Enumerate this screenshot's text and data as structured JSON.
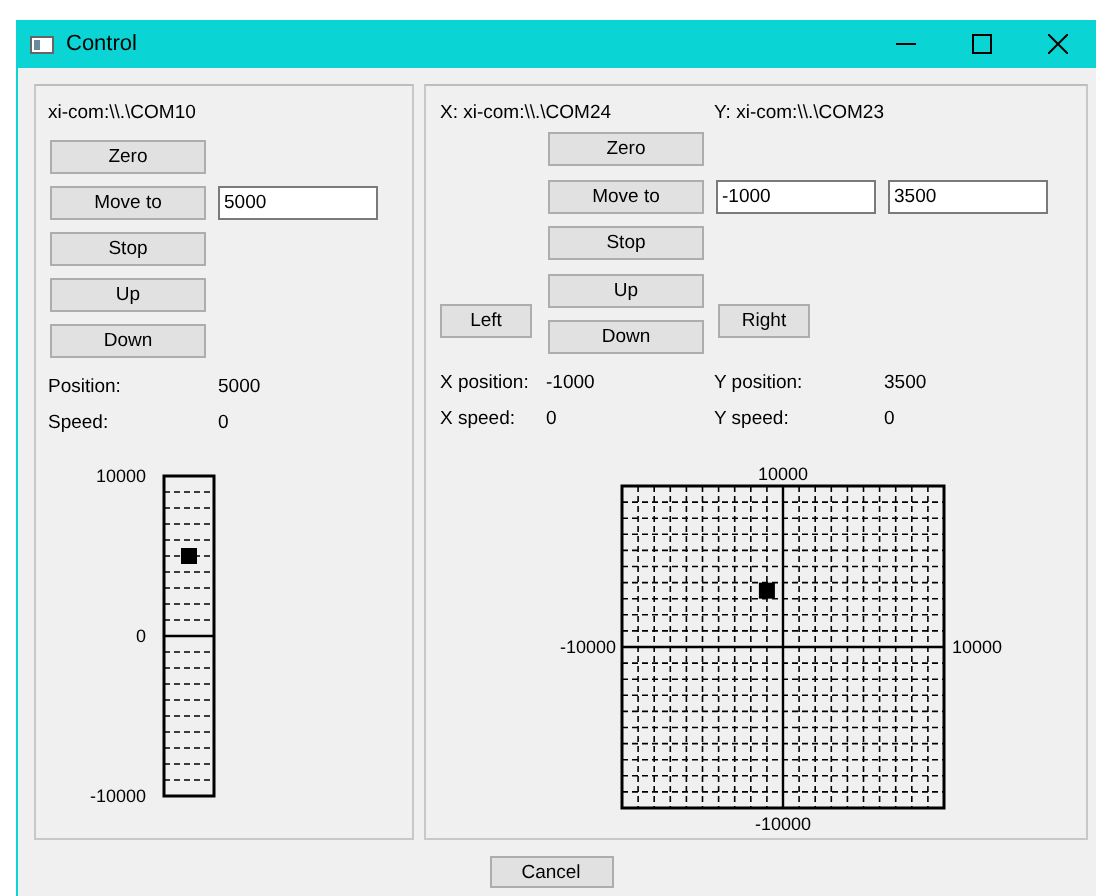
{
  "window": {
    "title": "Control"
  },
  "left": {
    "device": "xi-com:\\\\.\\COM10",
    "buttons": [
      {
        "label": "Zero"
      },
      {
        "label": "Move to",
        "inputs": [
          "5000"
        ]
      },
      {
        "label": "Stop"
      },
      {
        "label": "Up"
      },
      {
        "label": "Down"
      }
    ],
    "readouts": [
      {
        "label": "Position:",
        "value": "5000"
      },
      {
        "label": "Speed:",
        "value": "0"
      }
    ],
    "scale": {
      "ticks": [
        "10000",
        "0",
        "-10000"
      ],
      "level": 0.75
    }
  },
  "right": {
    "x_device": "X: xi-com:\\\\.\\COM24",
    "y_device": "Y: xi-com:\\\\.\\COM23",
    "buttons": [
      {
        "label": "Zero"
      },
      {
        "label": "Move to",
        "inputs": [
          "-1000",
          "3500"
        ]
      },
      {
        "label": "Stop"
      },
      {
        "label": "Up"
      },
      {
        "label": "Down"
      }
    ],
    "side_buttons": [
      "Left",
      "Right"
    ],
    "readouts": [
      {
        "label": "X position:",
        "value": "-1000"
      },
      {
        "label": "Y position:",
        "value": "3500"
      },
      {
        "label": "X speed:",
        "value": "0"
      },
      {
        "label": "Y speed:",
        "value": "0"
      }
    ],
    "chart_data": {
      "type": "scatter",
      "x": [
        -1000
      ],
      "values": [
        3500
      ],
      "xlim": [
        -10000,
        10000
      ],
      "ylim": [
        -10000,
        10000
      ],
      "xticks": [
        -10000,
        10000
      ],
      "yticks": [
        -10000,
        10000
      ]
    }
  },
  "footer": {
    "cancel": "Cancel"
  }
}
